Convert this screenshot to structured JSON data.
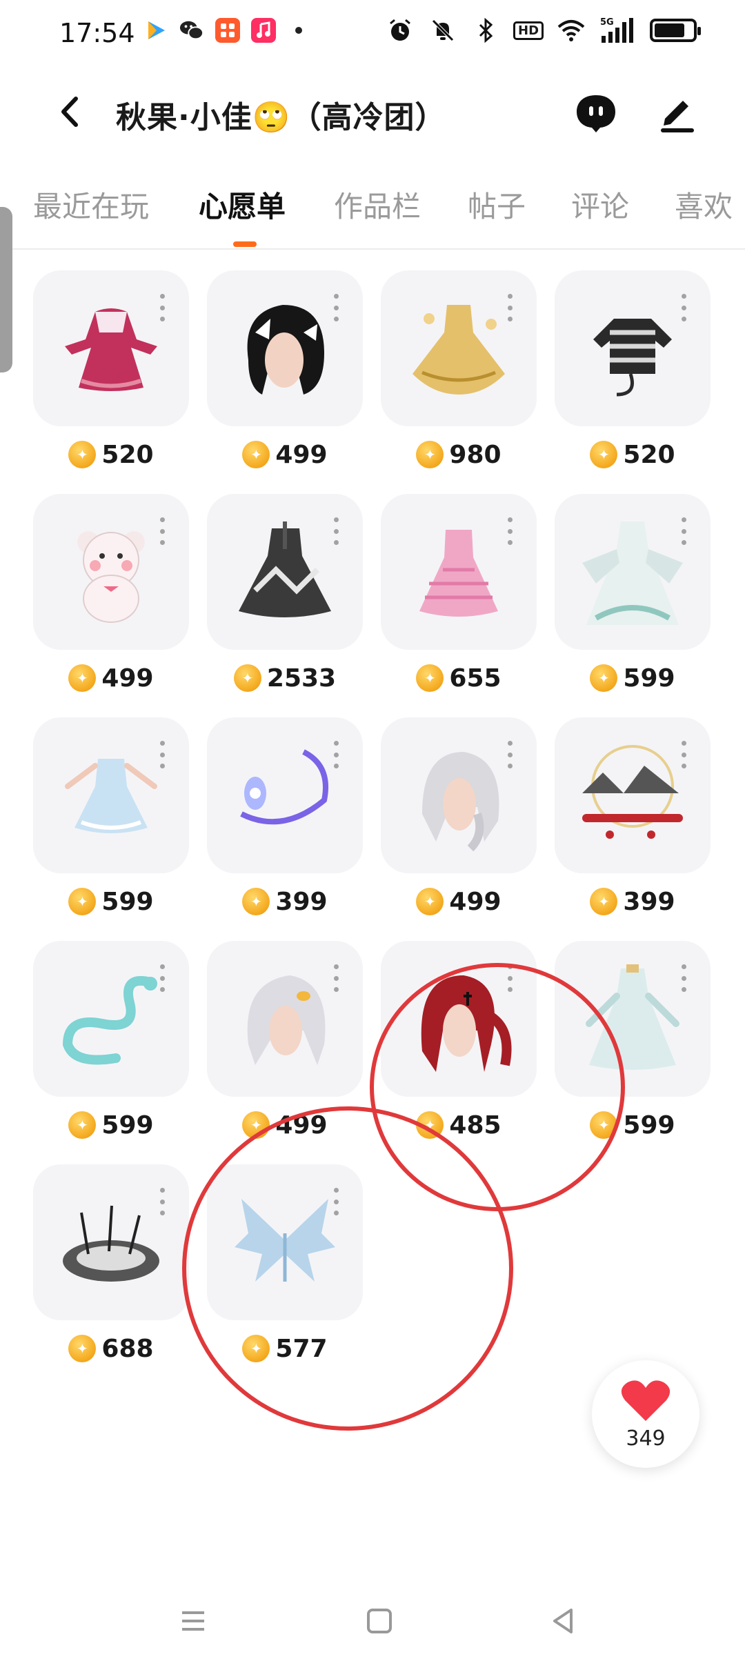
{
  "status_bar": {
    "time": "17:54",
    "notification_icons": [
      "play-icon",
      "wechat-icon",
      "app-icon",
      "music-icon"
    ],
    "system_icons": [
      "alarm-icon",
      "mute-icon",
      "bluetooth-icon",
      "hd-icon",
      "wifi-icon",
      "5g-signal-icon",
      "battery-icon"
    ],
    "hd_label": "HD",
    "network_label": "5G"
  },
  "header": {
    "title": "秋果·小佳🙄（高冷团）"
  },
  "tabs": [
    {
      "label": "最近在玩"
    },
    {
      "label": "心愿单",
      "active": true
    },
    {
      "label": "作品栏"
    },
    {
      "label": "帖子"
    },
    {
      "label": "评论"
    },
    {
      "label": "喜欢"
    }
  ],
  "wishlist": [
    {
      "price": "520",
      "item": "pink-dress-outfit"
    },
    {
      "price": "499",
      "item": "black-hair-with-bow"
    },
    {
      "price": "980",
      "item": "golden-gown"
    },
    {
      "price": "520",
      "item": "striped-cat-hoodie"
    },
    {
      "price": "499",
      "item": "teddy-bear"
    },
    {
      "price": "2533",
      "item": "gothic-dress"
    },
    {
      "price": "655",
      "item": "pink-gingham-dress"
    },
    {
      "price": "599",
      "item": "hanfu-gown"
    },
    {
      "price": "599",
      "item": "light-blue-dress"
    },
    {
      "price": "399",
      "item": "purple-glow-effect"
    },
    {
      "price": "499",
      "item": "silver-braid-hair"
    },
    {
      "price": "399",
      "item": "ink-landscape-scene"
    },
    {
      "price": "599",
      "item": "cyan-dragon"
    },
    {
      "price": "499",
      "item": "silver-hair-with-clip"
    },
    {
      "price": "485",
      "item": "red-ponytail-hair"
    },
    {
      "price": "599",
      "item": "pale-blue-gown"
    },
    {
      "price": "688",
      "item": "dark-platform-spikes"
    },
    {
      "price": "577",
      "item": "ice-wings"
    }
  ],
  "like": {
    "count": "349"
  },
  "colors": {
    "accent": "#ff6b1a",
    "annotation": "#e0393b",
    "coin": "#f4a81d"
  }
}
